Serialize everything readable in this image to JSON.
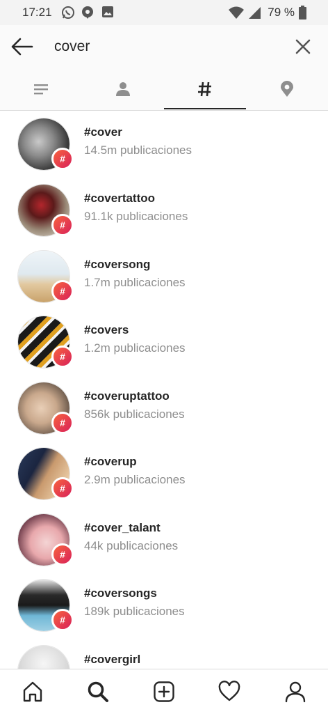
{
  "status_bar": {
    "time": "17:21",
    "left_icons": [
      "whatsapp-icon",
      "location-pin-icon",
      "image-icon"
    ],
    "battery_text": "79 %",
    "right_icons": [
      "wifi-icon",
      "signal-icon",
      "battery-icon"
    ]
  },
  "search": {
    "query": "cover",
    "back_icon": "arrow-left-icon",
    "clear_icon": "close-icon"
  },
  "tabs": [
    {
      "name": "top",
      "icon": "list-icon",
      "selected": false
    },
    {
      "name": "accounts",
      "icon": "person-icon",
      "selected": false
    },
    {
      "name": "tags",
      "icon": "hashtag-icon",
      "selected": true
    },
    {
      "name": "places",
      "icon": "location-pin-icon",
      "selected": false
    }
  ],
  "results": [
    {
      "tag": "#cover",
      "count": "14.5m publicaciones"
    },
    {
      "tag": "#covertattoo",
      "count": "91.1k publicaciones"
    },
    {
      "tag": "#coversong",
      "count": "1.7m publicaciones"
    },
    {
      "tag": "#covers",
      "count": "1.2m publicaciones"
    },
    {
      "tag": "#coveruptattoo",
      "count": "856k publicaciones"
    },
    {
      "tag": "#coverup",
      "count": "2.9m publicaciones"
    },
    {
      "tag": "#cover_talant",
      "count": "44k publicaciones"
    },
    {
      "tag": "#coversongs",
      "count": "189k publicaciones"
    },
    {
      "tag": "#covergirl",
      "count": ""
    }
  ],
  "badge_symbol": "#",
  "bottom_nav": [
    {
      "name": "home",
      "icon": "home-icon"
    },
    {
      "name": "search",
      "icon": "search-icon",
      "selected": true
    },
    {
      "name": "new-post",
      "icon": "add-square-icon"
    },
    {
      "name": "activity",
      "icon": "heart-icon"
    },
    {
      "name": "profile",
      "icon": "profile-icon"
    }
  ],
  "colors": {
    "badge_gradient_start": "#f6633e",
    "badge_gradient_end": "#d9215a",
    "text_primary": "#262626",
    "text_secondary": "#8e8e8e"
  }
}
